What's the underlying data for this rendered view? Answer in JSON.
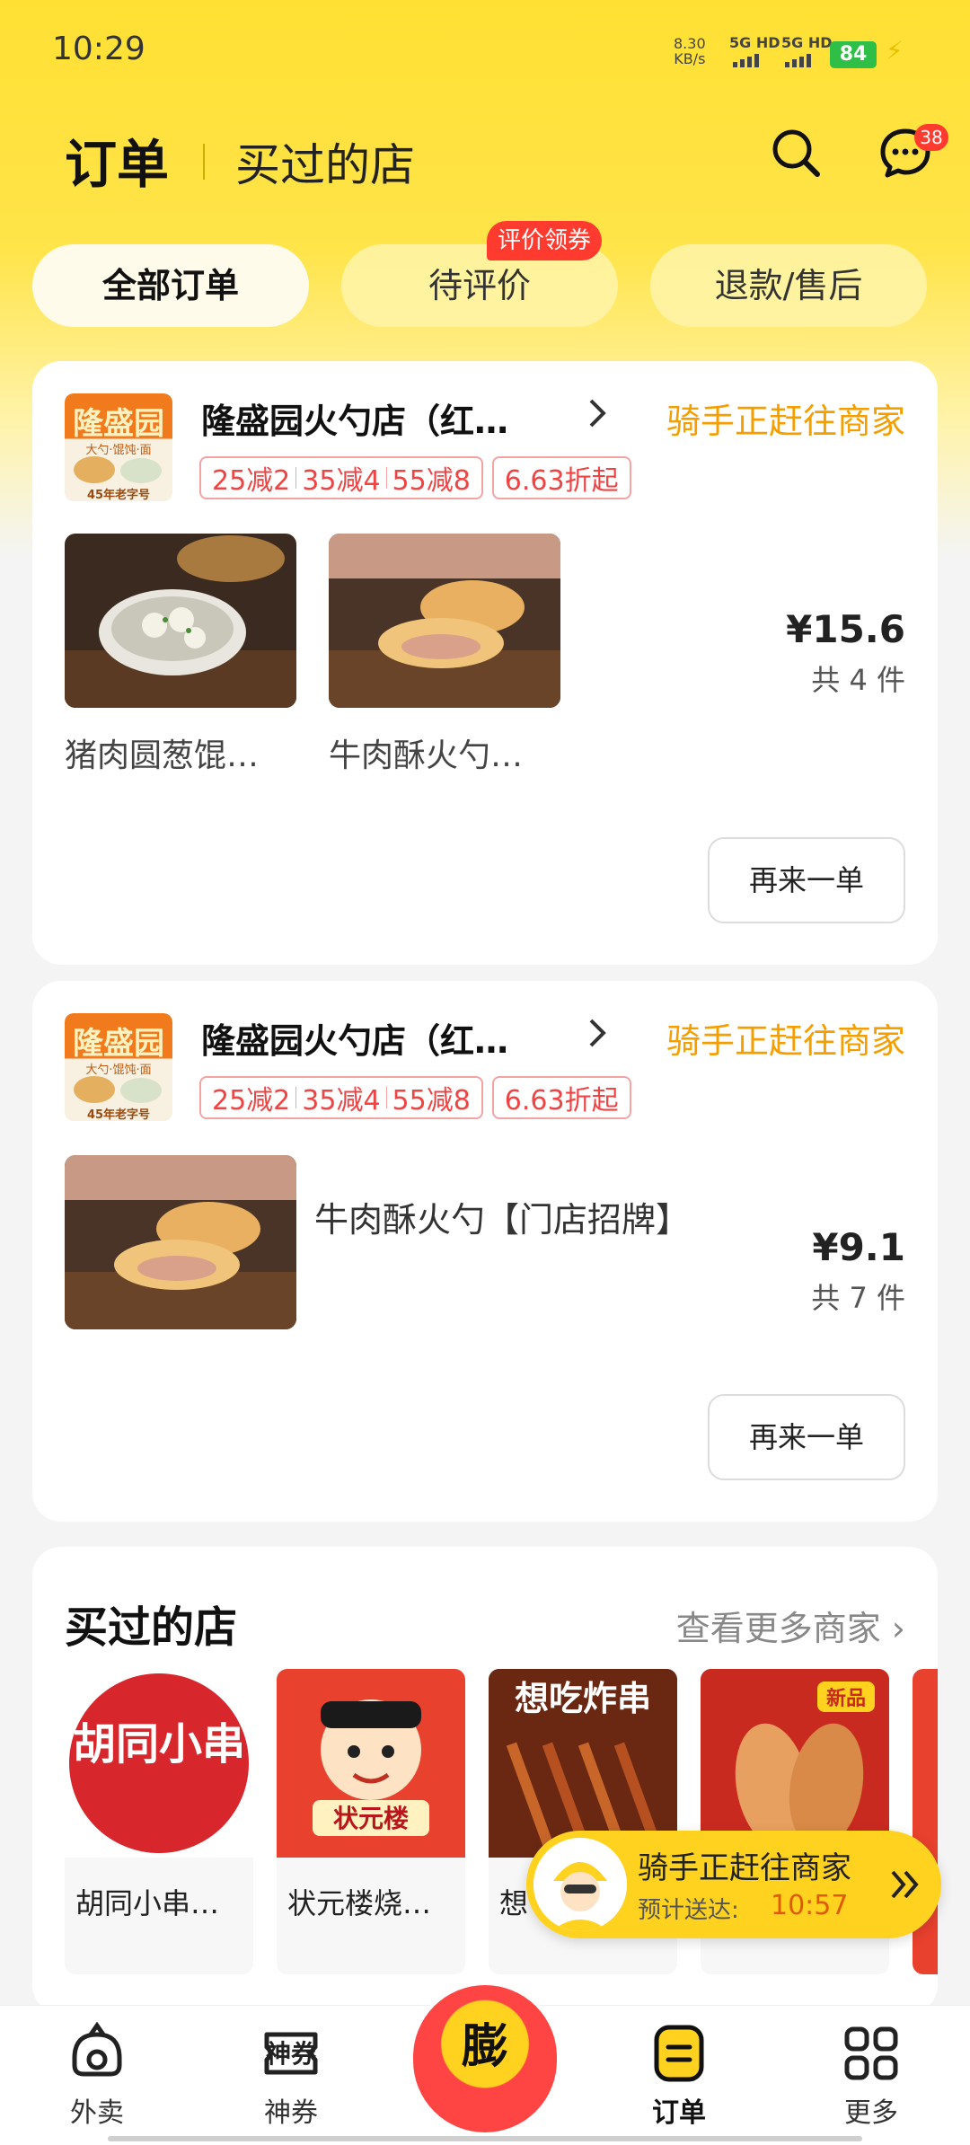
{
  "status_bar": {
    "time": "10:29",
    "net_speed_value": "8.30",
    "net_speed_unit": "KB/s",
    "signal1": "5G HD",
    "signal2": "5G HD",
    "battery": "84"
  },
  "header": {
    "title": "订单",
    "subtitle": "买过的店",
    "message_badge": "38"
  },
  "tabs": [
    {
      "label": "全部订单",
      "active": true
    },
    {
      "label": "待评价",
      "active": false
    },
    {
      "label": "退款/售后",
      "active": false
    }
  ],
  "tab_badge": "评价领券",
  "orders": [
    {
      "shop_name": "隆盛园火勺店（红…",
      "status": "骑手正赶往商家",
      "promos": [
        "25减2",
        "35减4",
        "55减8"
      ],
      "discount": "6.63折起",
      "items": [
        {
          "name": "猪肉圆葱馄…"
        },
        {
          "name": "牛肉酥火勺…"
        }
      ],
      "price": "¥15.6",
      "quantity": "共 4 件",
      "reorder_label": "再来一单"
    },
    {
      "shop_name": "隆盛园火勺店（红…",
      "status": "骑手正赶往商家",
      "promos": [
        "25减2",
        "35减4",
        "55减8"
      ],
      "discount": "6.63折起",
      "item_desc": "牛肉酥火勺【门店招牌】",
      "price": "¥9.1",
      "quantity": "共 7 件",
      "reorder_label": "再来一单"
    }
  ],
  "shop_logo": {
    "name": "隆盛园",
    "tagline": "大勺·馄饨·面",
    "badge": "45年老字号"
  },
  "bought_shops": {
    "title": "买过的店",
    "more_link": "查看更多商家",
    "shops": [
      {
        "name": "胡同小串…",
        "logo_text": "胡同小串"
      },
      {
        "name": "状元楼烧…",
        "logo_text": "状元楼"
      },
      {
        "name": "想",
        "logo_text": "想吃炸串"
      },
      {
        "name": "",
        "logo_text": "新品"
      }
    ]
  },
  "rider_float": {
    "title": "骑手正赶往商家",
    "eta_label": "预计送达:",
    "eta_time": "10:57"
  },
  "bottom_nav": [
    {
      "label": "外卖",
      "icon": "takeout-icon",
      "active": false
    },
    {
      "label": "神券",
      "icon": "coupon-icon",
      "active": false
    },
    {
      "label": "膨",
      "icon": "promo-center-icon",
      "active": false
    },
    {
      "label": "订单",
      "icon": "orders-icon",
      "active": true
    },
    {
      "label": "更多",
      "icon": "more-grid-icon",
      "active": false
    }
  ],
  "colors": {
    "brand_yellow": "#ffd21f",
    "status_orange": "#f59e00",
    "promo_red": "#ef4444",
    "badge_red": "#ff3b30"
  }
}
